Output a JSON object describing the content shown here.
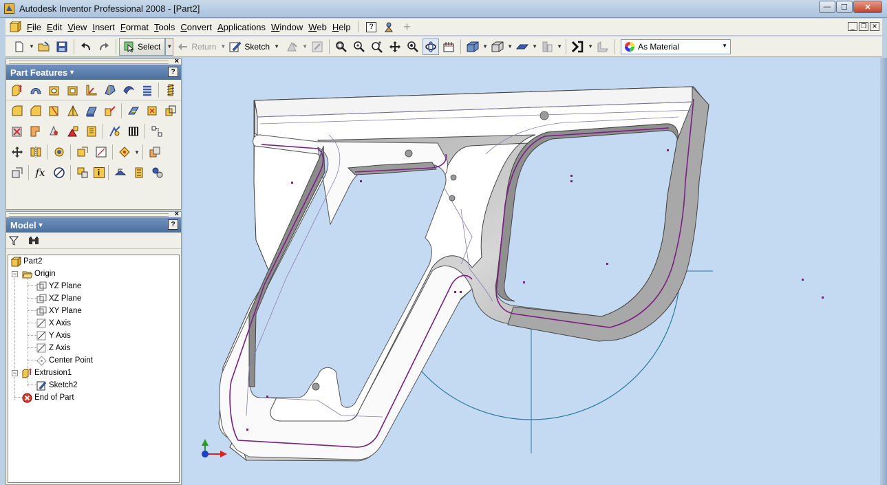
{
  "window": {
    "title": "Autodesk Inventor Professional 2008 - [Part2]",
    "minimize_glyph": "—",
    "maximize_glyph": "☐",
    "close_glyph": "✕"
  },
  "menu": {
    "items": [
      "File",
      "Edit",
      "View",
      "Insert",
      "Format",
      "Tools",
      "Convert",
      "Applications",
      "Window",
      "Web",
      "Help"
    ],
    "help_glyph": "?",
    "add_glyph": "+",
    "mdi": [
      "_",
      "❐",
      "✕"
    ]
  },
  "toolbar": {
    "select_label": "Select",
    "return_label": "Return",
    "sketch_label": "Sketch",
    "material_value": "As Material",
    "dropdown_glyph": "▼"
  },
  "part_features_panel": {
    "title": "Part Features",
    "title_arrow": "▾",
    "help_glyph": "?",
    "close_glyph": "×",
    "fx_glyph": "fx",
    "info_glyph": "i"
  },
  "model_panel": {
    "title": "Model",
    "title_arrow": "▾",
    "help_glyph": "?",
    "close_glyph": "×",
    "collapse_glyph": "−",
    "tree": {
      "root": "Part2",
      "origin": "Origin",
      "yz_plane": "YZ Plane",
      "xz_plane": "XZ Plane",
      "xy_plane": "XY Plane",
      "x_axis": "X Axis",
      "y_axis": "Y Axis",
      "z_axis": "Z Axis",
      "center_point": "Center Point",
      "extrusion": "Extrusion1",
      "sketch": "Sketch2",
      "end_of_part": "End of Part"
    }
  },
  "colors": {
    "viewport_bg": "#c4daf2",
    "sketch_circle": "#2b7a9e",
    "edge_highlight": "#7a1f82",
    "panel_header": "#5a7fb0"
  }
}
